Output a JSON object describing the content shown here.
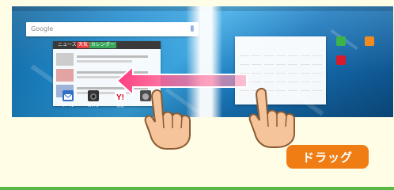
{
  "search": {
    "brand": "Google"
  },
  "news_widget": {
    "tabs": [
      "ニュース",
      "天気",
      "カレンダー"
    ],
    "rows": [
      {
        "thumb_color": "#cfcfcf"
      },
      {
        "thumb_color": "#e2a3a3"
      },
      {
        "thumb_color": "#9fb3d9"
      }
    ]
  },
  "dock": {
    "items": [
      {
        "label": "メール",
        "color": "#2f6fc6",
        "icon": "mail-icon"
      },
      {
        "label": "カメラ",
        "color": "#333333",
        "icon": "camera-icon"
      },
      {
        "label": "検索",
        "color": "#ffffff",
        "icon": "yahoo-icon"
      },
      {
        "label": "",
        "color": "#4c4c4c",
        "icon": "camera-icon"
      }
    ]
  },
  "calendar": {
    "rows": [
      [
        "",
        "",
        "",
        "",
        "",
        "",
        ""
      ],
      [
        "",
        "",
        "",
        "",
        "",
        "",
        ""
      ],
      [
        "",
        "",
        "",
        "",
        "",
        "",
        ""
      ],
      [
        "",
        "",
        "",
        "",
        "",
        "",
        ""
      ],
      [
        "",
        "",
        "",
        "",
        "",
        "",
        ""
      ]
    ],
    "today_color": "#3b7ddd"
  },
  "apps": [
    {
      "label": "",
      "color": "#3bb24a",
      "icon": "contacts-icon"
    },
    {
      "label": "",
      "color": "#f28a1e",
      "icon": "folder-icon"
    },
    {
      "label": "",
      "color": "#d81b2a",
      "icon": "flag-icon"
    }
  ],
  "side_icons": [
    {
      "color": "#37a04b",
      "icon": "green-app-icon"
    },
    {
      "color": "#2b6fd1",
      "icon": "blue-app-icon"
    },
    {
      "color": "#d32f2f",
      "icon": "yahoo-icon"
    },
    {
      "color": "#eeeeee",
      "icon": "apps-grid-icon"
    }
  ],
  "gesture": {
    "badge_label": "ドラッグ",
    "badge_color": "#ef7d14",
    "arrow_color": "#ff5a88"
  }
}
